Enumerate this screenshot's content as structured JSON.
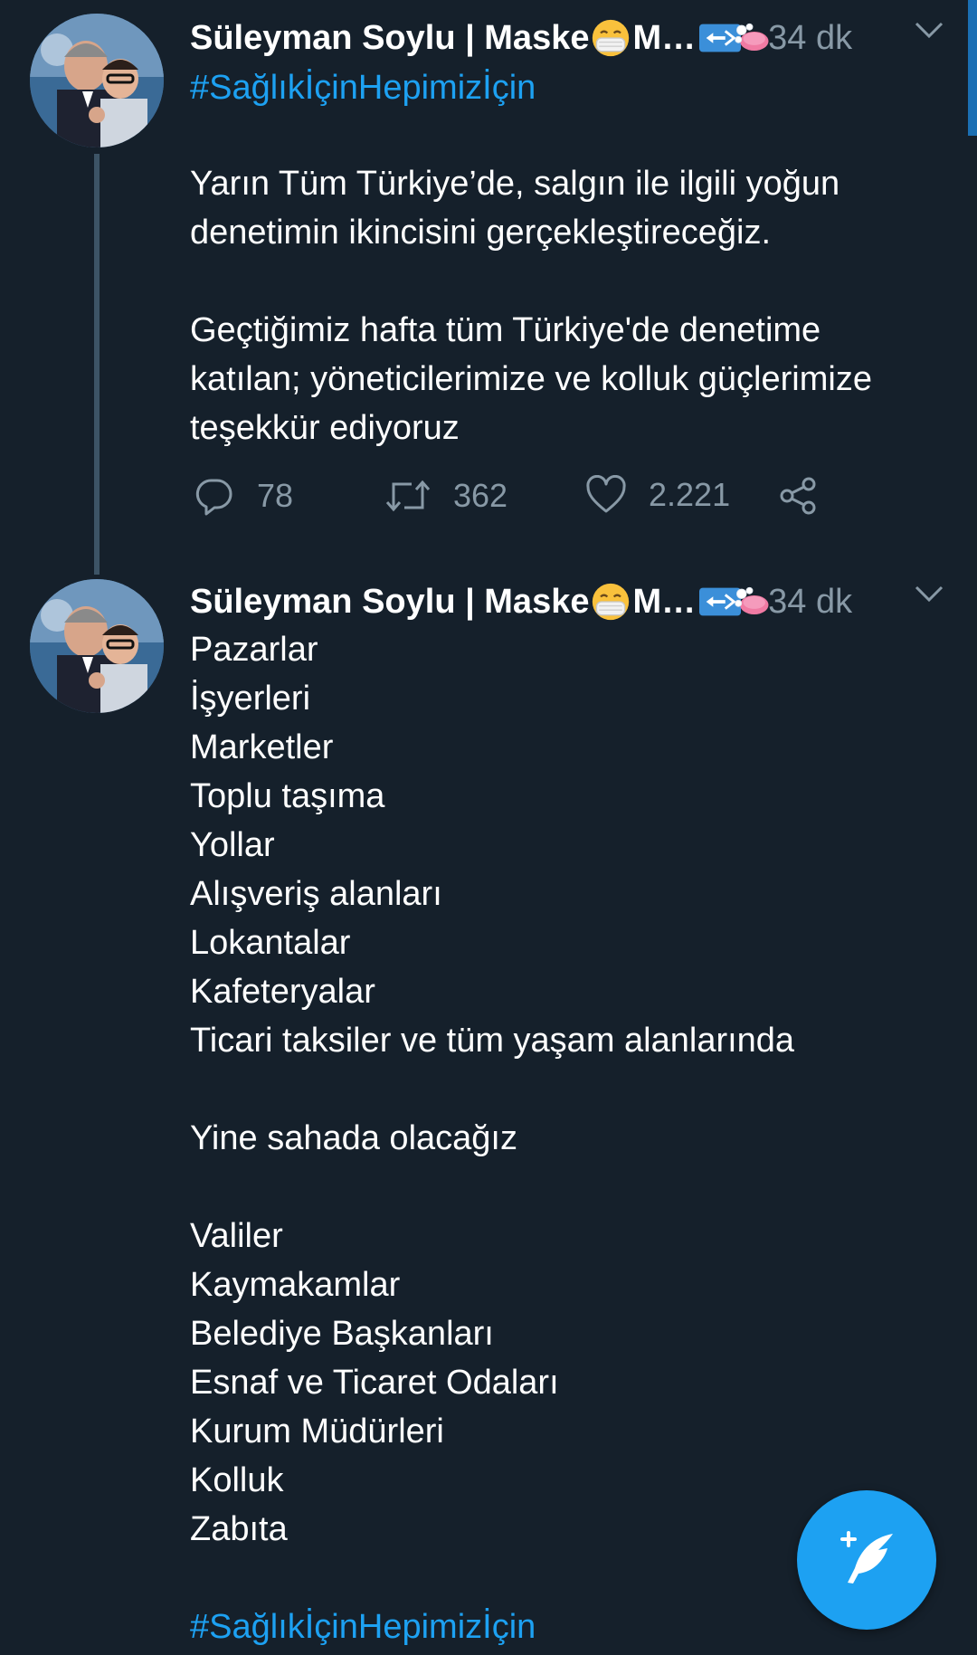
{
  "tweets": [
    {
      "author_name_before_emoji": "Süleyman Soylu | Maske",
      "author_name_after_emoji": " M…",
      "time": "34 dk",
      "hashtag": "#SağlıkİçinHepimizİçin",
      "body_lines": [
        "Yarın Tüm Türkiye’de, salgın ile ilgili yoğun",
        "denetimin ikincisini gerçekleştireceğiz.",
        "",
        "Geçtiğimiz hafta tüm Türkiye'de denetime",
        "katılan; yöneticilerimize ve kolluk güçlerimize",
        "teşekkür ediyoruz"
      ],
      "replies": "78",
      "retweets": "362",
      "likes": "2.221"
    },
    {
      "author_name_before_emoji": "Süleyman Soylu | Maske",
      "author_name_after_emoji": " M…",
      "time": "34 dk",
      "body_lines": [
        "Pazarlar",
        "İşyerleri",
        "Marketler",
        "Toplu taşıma",
        "Yollar",
        "Alışveriş alanları",
        "Lokantalar",
        "Kafeteryalar",
        "Ticari taksiler ve tüm yaşam alanlarında",
        "",
        "Yine sahada olacağız",
        "",
        "Valiler",
        "Kaymakamlar",
        "Belediye Başkanları",
        "Esnaf ve Ticaret Odaları",
        "Kurum Müdürleri",
        "Kolluk",
        "Zabıta",
        ""
      ],
      "hashtag": "#SağlıkİçinHepimizİçin"
    }
  ],
  "icons": {
    "mask_emoji": "face-with-medical-mask-icon",
    "syringe_badge": "syringe-icon",
    "soap_badge": "soap-icon",
    "reply": "reply-icon",
    "retweet": "retweet-icon",
    "like": "heart-icon",
    "share": "share-icon",
    "caret": "chevron-down-icon",
    "compose": "compose-tweet-icon"
  },
  "colors": {
    "background": "#15202b",
    "accent": "#1da1f2",
    "secondary_text": "#8899a6"
  }
}
